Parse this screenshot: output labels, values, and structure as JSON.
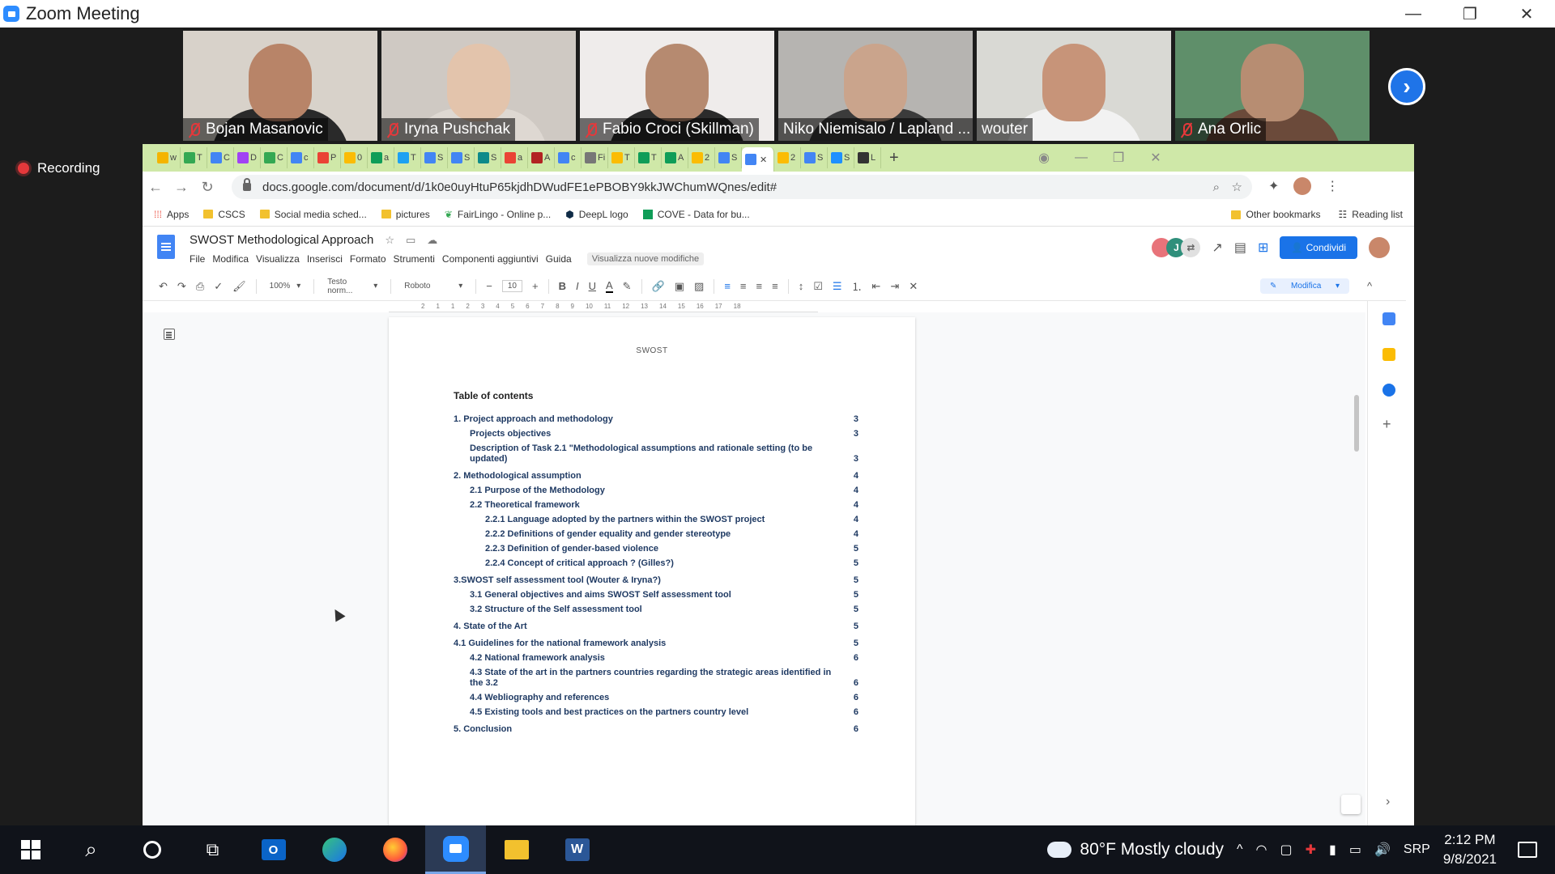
{
  "window": {
    "title": "Zoom Meeting",
    "minimize": "—",
    "restore": "❐",
    "close": "✕"
  },
  "participants": [
    {
      "name": "Bojan Masanovic",
      "muted": true,
      "bg": "#d8d2ca",
      "skin": "#b88468",
      "shirt": "#2a2a2a"
    },
    {
      "name": "Iryna Pushchak",
      "muted": true,
      "bg": "#cfc9c3",
      "skin": "#e3c4ac",
      "shirt": "#ded8d2"
    },
    {
      "name": "Fabio Croci (Skillman)",
      "muted": true,
      "bg": "#efeceb",
      "skin": "#b68a70",
      "shirt": "#2b2b2b"
    },
    {
      "name": "Niko Niemisalo / Lapland ...",
      "muted": false,
      "bg": "#b6b4b1",
      "skin": "#caa48c",
      "shirt": "#3b3b3b"
    },
    {
      "name": "wouter",
      "muted": false,
      "bg": "#d9d9d4",
      "skin": "#c79479",
      "shirt": "#f2f2f2",
      "active": true
    },
    {
      "name": "Ana Orlic",
      "muted": true,
      "bg": "#5f8f6a",
      "skin": "#b78d72",
      "shirt": "#6b4a3a"
    }
  ],
  "recording_label": "Recording",
  "browser": {
    "url": "docs.google.com/document/d/1k0e0uyHtuP65kjdhDWudFE1ePBOBY9kkJWChumWQnes/edit#",
    "tabs": [
      {
        "label": "w",
        "color": "#f4b400"
      },
      {
        "label": "T",
        "color": "#34a853"
      },
      {
        "label": "C",
        "color": "#4285f4"
      },
      {
        "label": "D",
        "color": "#a142f4"
      },
      {
        "label": "C",
        "color": "#34a853"
      },
      {
        "label": "c",
        "color": "#4285f4"
      },
      {
        "label": "P",
        "color": "#ea4335"
      },
      {
        "label": "0",
        "color": "#fbbc04"
      },
      {
        "label": "a",
        "color": "#0f9d58"
      },
      {
        "label": "T",
        "color": "#1da1f2"
      },
      {
        "label": "S",
        "color": "#4285f4"
      },
      {
        "label": "S",
        "color": "#4285f4"
      },
      {
        "label": "S",
        "color": "#0e8a8a"
      },
      {
        "label": "a",
        "color": "#ea4335"
      },
      {
        "label": "A",
        "color": "#b22222"
      },
      {
        "label": "c",
        "color": "#4285f4"
      },
      {
        "label": "Fi",
        "color": "#777777"
      },
      {
        "label": "T",
        "color": "#fbbc04"
      },
      {
        "label": "T",
        "color": "#0f9d58"
      },
      {
        "label": "A",
        "color": "#0f9d58"
      },
      {
        "label": "2",
        "color": "#fbbc04"
      },
      {
        "label": "S",
        "color": "#4285f4"
      },
      {
        "label": "",
        "color": "#4285f4",
        "active": true
      },
      {
        "label": "2",
        "color": "#fbbc04"
      },
      {
        "label": "S",
        "color": "#4285f4"
      },
      {
        "label": "S",
        "color": "#1e90ff"
      },
      {
        "label": "L",
        "color": "#333333"
      }
    ],
    "tab_plus": "+",
    "bookmarks": [
      {
        "label": "Apps",
        "icon": "apps-grid"
      },
      {
        "label": "CSCS",
        "icon": "folder"
      },
      {
        "label": "Social media sched...",
        "icon": "folder"
      },
      {
        "label": "pictures",
        "icon": "folder"
      },
      {
        "label": "FairLingo - Online p...",
        "icon": "fairlingo"
      },
      {
        "label": "DeepL logo",
        "icon": "deepl"
      },
      {
        "label": "COVE - Data for bu...",
        "icon": "sheets"
      }
    ],
    "other_bookmarks": "Other bookmarks",
    "reading_list": "Reading list"
  },
  "docs": {
    "title": "SWOST Methodological Approach",
    "menu": [
      "File",
      "Modifica",
      "Visualizza",
      "Inserisci",
      "Formato",
      "Strumenti",
      "Componenti aggiuntivi",
      "Guida"
    ],
    "menu_badge": "Visualizza nuove modifiche",
    "share": "Condividi",
    "collaborator_initial": "J",
    "toolbar": {
      "zoom": "100%",
      "style": "Testo norm...",
      "font": "Roboto",
      "size": "10",
      "mode": "Modifica"
    },
    "ruler_marks": [
      "2",
      "1",
      "1",
      "2",
      "3",
      "4",
      "5",
      "6",
      "7",
      "8",
      "9",
      "10",
      "11",
      "12",
      "13",
      "14",
      "15",
      "16",
      "17",
      "18"
    ],
    "page_header": "SWOST",
    "toc_title": "Table of contents",
    "toc": [
      {
        "text": "1.  Project approach and methodology",
        "page": "3",
        "level": 1
      },
      {
        "text": "Projects objectives",
        "page": "3",
        "level": 2
      },
      {
        "text": "Description of Task 2.1 \"Methodological assumptions and rationale setting (to be updated)",
        "page": "3",
        "level": 2
      },
      {
        "text": "2. Methodological assumption",
        "page": "4",
        "level": 1,
        "gap": true
      },
      {
        "text": "2.1 Purpose of the Methodology",
        "page": "4",
        "level": 2
      },
      {
        "text": "2.2 Theoretical framework",
        "page": "4",
        "level": 2
      },
      {
        "text": "2.2.1 Language adopted by the partners within the SWOST project",
        "page": "4",
        "level": 3
      },
      {
        "text": "2.2.2 Definitions of gender equality and gender stereotype",
        "page": "4",
        "level": 3
      },
      {
        "text": "2.2.3 Definition of gender-based violence",
        "page": "5",
        "level": 3
      },
      {
        "text": "2.2.4 Concept of critical approach ? (Gilles?)",
        "page": "5",
        "level": 3
      },
      {
        "text": "3.SWOST self assessment tool (Wouter & Iryna?)",
        "page": "5",
        "level": 1,
        "gap": true
      },
      {
        "text": "3.1  General objectives and aims SWOST Self assessment tool",
        "page": "5",
        "level": 2
      },
      {
        "text": "3.2 Structure of the Self assessment tool",
        "page": "5",
        "level": 2
      },
      {
        "text": "4. State of the Art",
        "page": "5",
        "level": 1,
        "gap": true
      },
      {
        "text": "4.1 Guidelines for the national framework analysis",
        "page": "5",
        "level": 1,
        "gap": true
      },
      {
        "text": "4.2 National framework analysis",
        "page": "6",
        "level": 2
      },
      {
        "text": "4.3 State of the art in the partners countries regarding the strategic areas identified in the 3.2",
        "page": "6",
        "level": 2
      },
      {
        "text": "4.4 Webliography and references",
        "page": "6",
        "level": 2
      },
      {
        "text": "4.5  Existing tools and best practices on the partners country level",
        "page": "6",
        "level": 2
      },
      {
        "text": "5. Conclusion",
        "page": "6",
        "level": 1,
        "gap": true
      }
    ]
  },
  "taskbar": {
    "weather": "80°F  Mostly cloudy",
    "language": "SRP",
    "time": "2:12 PM",
    "date": "9/8/2021"
  }
}
